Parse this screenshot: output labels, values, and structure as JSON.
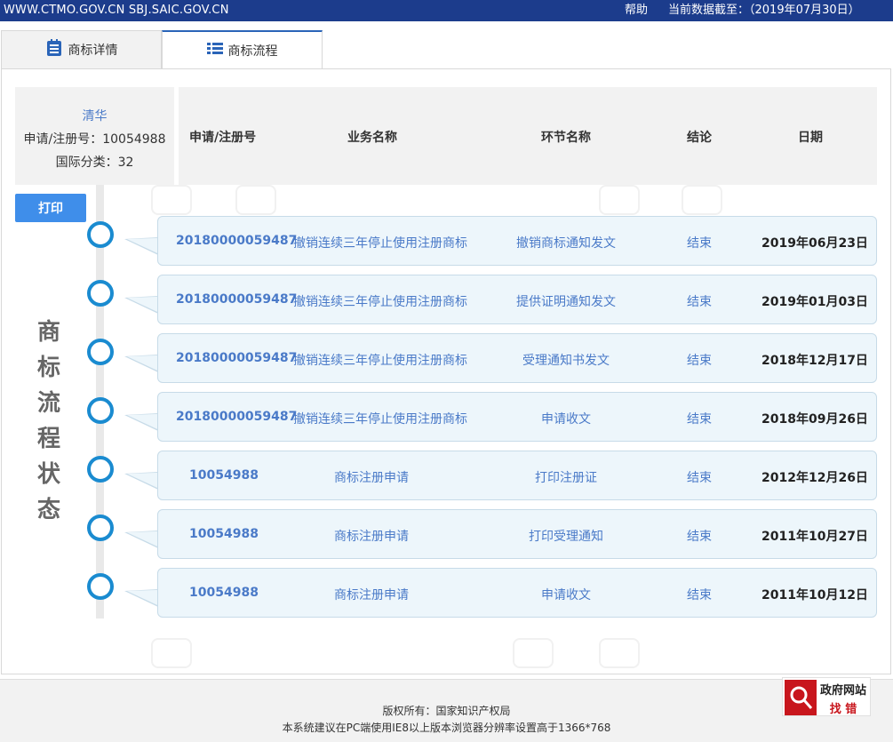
{
  "topbar": {
    "site": "WWW.CTMO.GOV.CN SBJ.SAIC.GOV.CN",
    "help": "帮助",
    "date_text": "当前数据截至：（2019年07月30日）"
  },
  "tabs": [
    {
      "label": "商标详情",
      "icon": "document-list-icon"
    },
    {
      "label": "商标流程",
      "icon": "list-icon"
    }
  ],
  "info": {
    "name": "清华",
    "reg_no": "申请/注册号：10054988",
    "class": "国际分类：32"
  },
  "table": {
    "headers": [
      "申请/注册号",
      "业务名称",
      "环节名称",
      "结论",
      "日期"
    ]
  },
  "print_label": "打印",
  "timeline_title": "商标流程状态",
  "rows": [
    {
      "number": "20180000059487",
      "business": "撤销连续三年停止使用注册商标",
      "step": "撤销商标通知发文",
      "result": "结束",
      "date": "2019年06月23日"
    },
    {
      "number": "20180000059487",
      "business": "撤销连续三年停止使用注册商标",
      "step": "提供证明通知发文",
      "result": "结束",
      "date": "2019年01月03日"
    },
    {
      "number": "20180000059487",
      "business": "撤销连续三年停止使用注册商标",
      "step": "受理通知书发文",
      "result": "结束",
      "date": "2018年12月17日"
    },
    {
      "number": "20180000059487",
      "business": "撤销连续三年停止使用注册商标",
      "step": "申请收文",
      "result": "结束",
      "date": "2018年09月26日"
    },
    {
      "number": "10054988",
      "business": "商标注册申请",
      "step": "打印注册证",
      "result": "结束",
      "date": "2012年12月26日"
    },
    {
      "number": "10054988",
      "business": "商标注册申请",
      "step": "打印受理通知",
      "result": "结束",
      "date": "2011年10月27日"
    },
    {
      "number": "10054988",
      "business": "商标注册申请",
      "step": "申请收文",
      "result": "结束",
      "date": "2011年10月12日"
    }
  ],
  "footer": {
    "line1": "版权所有：国家知识产权局",
    "line2": "本系统建议在PC端使用IE8以上版本浏览器分辨率设置高于1366*768"
  },
  "gov_badge": {
    "line1": "政府网站",
    "line2": "找 错"
  },
  "colors": {
    "topbar": "#1c3c8c",
    "accent": "#3f8eea",
    "link": "#4a7ac8",
    "timeline_circle": "#1a8bd0",
    "card_bg": "#edf6fb"
  }
}
